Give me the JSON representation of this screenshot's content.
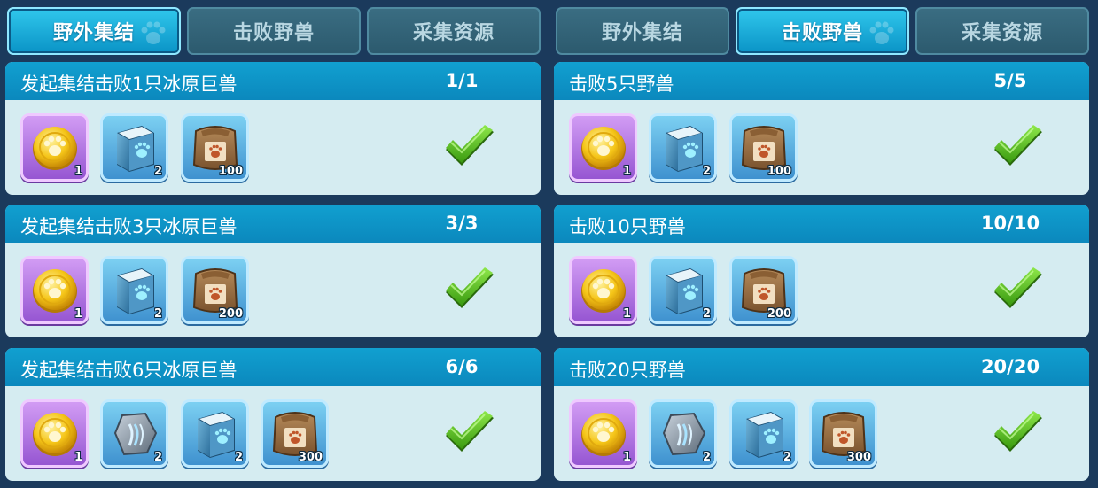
{
  "colors": {
    "tab_active": "#12abd9",
    "tab_inactive": "#33667a",
    "card_header": "#0e94c8",
    "card_body": "#d5ecf1",
    "check_green": "#5cc41a"
  },
  "left_panel": {
    "tabs": [
      {
        "label": "野外集结",
        "active": true
      },
      {
        "label": "击败野兽",
        "active": false
      },
      {
        "label": "采集资源",
        "active": false
      }
    ],
    "tasks": [
      {
        "title": "发起集结击败1只冰原巨兽",
        "progress": "1/1",
        "completed": true,
        "rewards": [
          {
            "icon": "paw-coin-icon",
            "qty": "1"
          },
          {
            "icon": "skill-book-icon",
            "qty": "2"
          },
          {
            "icon": "resource-sack-icon",
            "qty": "100"
          }
        ]
      },
      {
        "title": "发起集结击败3只冰原巨兽",
        "progress": "3/3",
        "completed": true,
        "rewards": [
          {
            "icon": "paw-coin-icon",
            "qty": "1"
          },
          {
            "icon": "skill-book-icon",
            "qty": "2"
          },
          {
            "icon": "resource-sack-icon",
            "qty": "200"
          }
        ]
      },
      {
        "title": "发起集结击败6只冰原巨兽",
        "progress": "6/6",
        "completed": true,
        "rewards": [
          {
            "icon": "paw-coin-icon",
            "qty": "1"
          },
          {
            "icon": "stone-icon",
            "qty": "2"
          },
          {
            "icon": "skill-book-icon",
            "qty": "2"
          },
          {
            "icon": "resource-sack-icon",
            "qty": "300"
          }
        ]
      }
    ]
  },
  "right_panel": {
    "tabs": [
      {
        "label": "野外集结",
        "active": false
      },
      {
        "label": "击败野兽",
        "active": true
      },
      {
        "label": "采集资源",
        "active": false
      }
    ],
    "tasks": [
      {
        "title": "击败5只野兽",
        "progress": "5/5",
        "completed": true,
        "rewards": [
          {
            "icon": "paw-coin-icon",
            "qty": "1"
          },
          {
            "icon": "skill-book-icon",
            "qty": "2"
          },
          {
            "icon": "resource-sack-icon",
            "qty": "100"
          }
        ]
      },
      {
        "title": "击败10只野兽",
        "progress": "10/10",
        "completed": true,
        "rewards": [
          {
            "icon": "paw-coin-icon",
            "qty": "1"
          },
          {
            "icon": "skill-book-icon",
            "qty": "2"
          },
          {
            "icon": "resource-sack-icon",
            "qty": "200"
          }
        ]
      },
      {
        "title": "击败20只野兽",
        "progress": "20/20",
        "completed": true,
        "rewards": [
          {
            "icon": "paw-coin-icon",
            "qty": "1"
          },
          {
            "icon": "stone-icon",
            "qty": "2"
          },
          {
            "icon": "skill-book-icon",
            "qty": "2"
          },
          {
            "icon": "resource-sack-icon",
            "qty": "300"
          }
        ]
      }
    ]
  }
}
